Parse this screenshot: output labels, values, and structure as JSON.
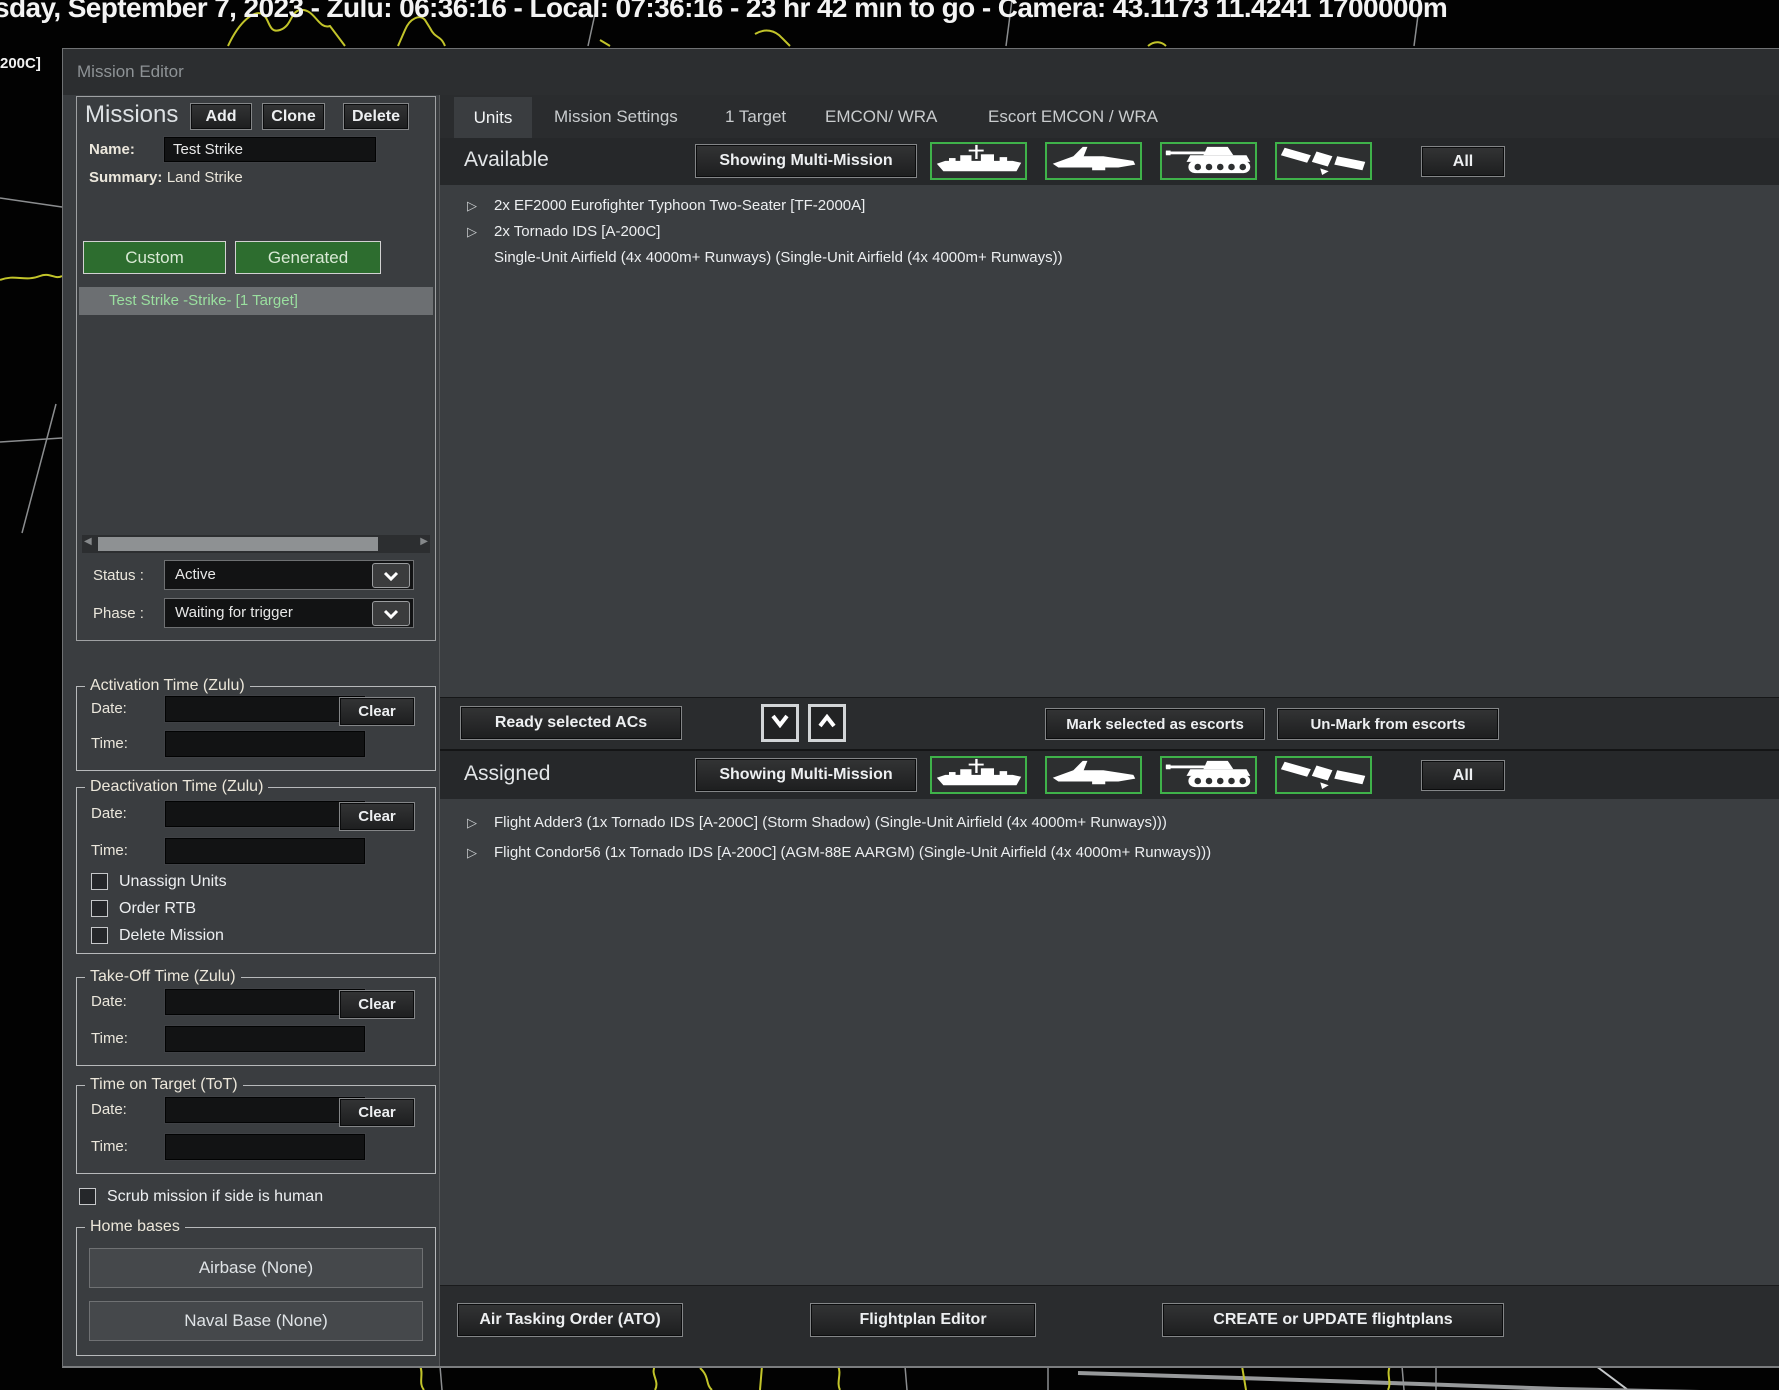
{
  "status_bar": {
    "text": "sday, September 7, 2023 - Zulu: 06:36:16 - Local: 07:36:16 - 23 hr 42 min to go -  Camera: 43.1173 11.4241 1700000m"
  },
  "map": {
    "unit_label": "200C]"
  },
  "window": {
    "title": "Mission Editor"
  },
  "missions": {
    "header": "Missions",
    "add_label": "Add",
    "clone_label": "Clone",
    "delete_label": "Delete",
    "name_label": "Name:",
    "name_value": "Test Strike",
    "summary_label": "Summary:",
    "summary_value": "Land Strike",
    "custom_label": "Custom",
    "generated_label": "Generated",
    "selected_mission": "Test Strike -Strike- [1 Target]",
    "status_label": "Status :",
    "status_value": "Active",
    "phase_label": "Phase :",
    "phase_value": "Waiting for trigger"
  },
  "labels": {
    "date": "Date:",
    "time": "Time:",
    "clear": "Clear"
  },
  "groups": {
    "activation": {
      "title": "Activation Time (Zulu)"
    },
    "deactivation": {
      "title": "Deactivation Time (Zulu)",
      "checkboxes": [
        "Unassign Units",
        "Order RTB",
        "Delete Mission"
      ]
    },
    "takeoff": {
      "title": "Take-Off Time (Zulu)"
    },
    "tot": {
      "title": "Time on Target (ToT)"
    }
  },
  "scrub_label": "Scrub mission if side is human",
  "home_bases": {
    "title": "Home bases",
    "airbase_label": "Airbase (None)",
    "naval_label": "Naval Base (None)"
  },
  "tabs": [
    "Units",
    "Mission Settings",
    "1 Target",
    "EMCON/ WRA",
    "Escort EMCON / WRA"
  ],
  "available": {
    "title": "Available",
    "filter_label": "Showing Multi-Mission",
    "all_label": "All",
    "items": [
      "2x EF2000 Eurofighter Typhoon Two-Seater [TF-2000A]",
      "2x Tornado IDS [A-200C]",
      "Single-Unit Airfield (4x 4000m+ Runways) (Single-Unit Airfield (4x 4000m+ Runways))"
    ]
  },
  "toolbar": {
    "ready_label": "Ready selected ACs",
    "mark_label": "Mark selected as escorts",
    "unmark_label": "Un-Mark from escorts"
  },
  "assigned": {
    "title": "Assigned",
    "filter_label": "Showing Multi-Mission",
    "all_label": "All",
    "items": [
      "Flight Adder3 (1x Tornado IDS [A-200C] (Storm Shadow) (Single-Unit Airfield (4x 4000m+ Runways)))",
      "Flight Condor56 (1x Tornado IDS [A-200C] (AGM-88E AARGM) (Single-Unit Airfield (4x 4000m+ Runways)))"
    ]
  },
  "footer": {
    "ato_label": "Air Tasking Order (ATO)",
    "flightplan_label": "Flightplan Editor",
    "create_label": "CREATE or UPDATE flightplans"
  },
  "colors": {
    "filter_border_green": "#3fb24a",
    "button_green": "#2d6d2f",
    "selected_mission_text": "#9adf9f",
    "map_line_yellow": "#c2c42a"
  }
}
